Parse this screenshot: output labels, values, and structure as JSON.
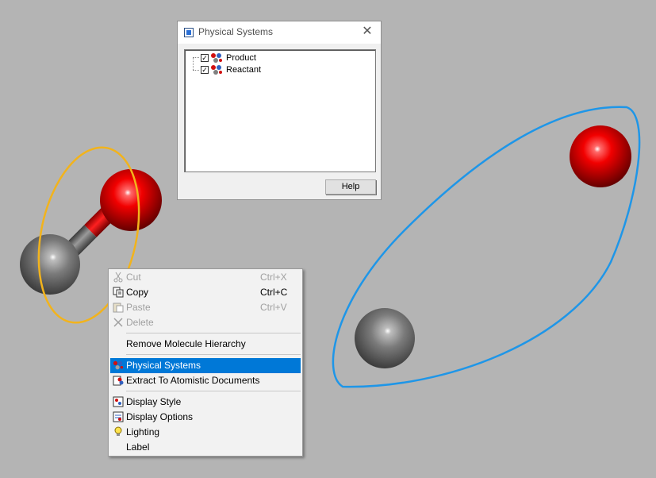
{
  "dialog": {
    "title": "Physical Systems",
    "close_glyph": "✕",
    "tree": [
      {
        "label": "Product",
        "checked": true,
        "icon": "molecule-system-icon"
      },
      {
        "label": "Reactant",
        "checked": true,
        "icon": "molecule-system-icon"
      }
    ],
    "help_label": "Help"
  },
  "menu": {
    "cut": {
      "label": "Cut",
      "shortcut": "Ctrl+X",
      "disabled": true,
      "icon": "scissors-icon"
    },
    "copy": {
      "label": "Copy",
      "shortcut": "Ctrl+C",
      "disabled": false,
      "icon": "copy-icon"
    },
    "paste": {
      "label": "Paste",
      "shortcut": "Ctrl+V",
      "disabled": true,
      "icon": "paste-icon"
    },
    "delete": {
      "label": "Delete",
      "disabled": true,
      "icon": "delete-x-icon"
    },
    "remove_hierarchy": {
      "label": "Remove Molecule Hierarchy"
    },
    "physical_systems": {
      "label": "Physical Systems",
      "highlighted": true,
      "icon": "molecule-system-icon"
    },
    "extract": {
      "label": "Extract To Atomistic Documents",
      "icon": "extract-icon"
    },
    "display_style": {
      "label": "Display Style",
      "icon": "display-style-icon"
    },
    "display_options": {
      "label": "Display Options",
      "icon": "display-options-icon"
    },
    "lighting": {
      "label": "Lighting",
      "icon": "lightbulb-icon"
    },
    "label": {
      "label": "Label"
    }
  },
  "colors": {
    "background": "#b4b4b4",
    "oxygen": "#e00000",
    "carbon": "#6e6e6e",
    "annotation_orange": "#f2b31c",
    "annotation_blue": "#1e96e8",
    "menu_highlight": "#0078d7"
  }
}
